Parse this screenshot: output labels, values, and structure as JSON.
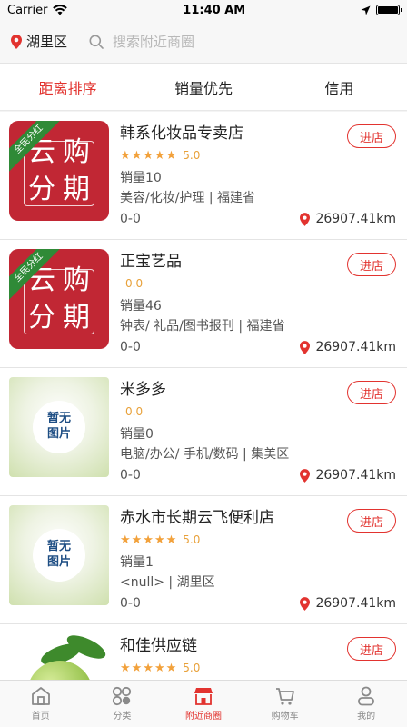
{
  "status_bar": {
    "carrier": "Carrier",
    "time": "11:40 AM"
  },
  "header": {
    "location": "湖里区",
    "search_placeholder": "搜索附近商圈"
  },
  "sort_tabs": [
    {
      "label": "距离排序",
      "active": true
    },
    {
      "label": "销量优先",
      "active": false
    },
    {
      "label": "信用",
      "active": false
    }
  ],
  "stores": [
    {
      "name": "韩系化妆品专卖店",
      "stars": "★★★★★",
      "score": "5.0",
      "sales": "销量10",
      "tags": "美容/化妆/护理 | 福建省",
      "hours": "0-0",
      "distance": "26907.41km",
      "enter_label": "进店",
      "thumb_text": [
        "云",
        "购",
        "分",
        "期"
      ],
      "ribbon": "全民分红"
    },
    {
      "name": "正宝艺品",
      "stars": "",
      "score": "0.0",
      "sales": "销量46",
      "tags": "钟表/ 礼品/图书报刊 | 福建省",
      "hours": "0-0",
      "distance": "26907.41km",
      "enter_label": "进店",
      "thumb_text": [
        "云",
        "购",
        "分",
        "期"
      ],
      "ribbon": "全民分红"
    },
    {
      "name": "米多多",
      "stars": "",
      "score": "0.0",
      "sales": "销量0",
      "tags": "电脑/办公/ 手机/数码 | 集美区",
      "hours": "0-0",
      "distance": "26907.41km",
      "enter_label": "进店",
      "thumb_text": [
        "暂无",
        "图片"
      ]
    },
    {
      "name": "赤水市长期云飞便利店",
      "stars": "★★★★★",
      "score": "5.0",
      "sales": "销量1",
      "tags": "<null> | 湖里区",
      "hours": "0-0",
      "distance": "26907.41km",
      "enter_label": "进店",
      "thumb_text": [
        "暂无",
        "图片"
      ]
    },
    {
      "name": "和佳供应链",
      "stars": "★★★★★",
      "score": "5.0",
      "sales": "",
      "tags": "",
      "hours": "",
      "distance": "",
      "enter_label": "进店"
    }
  ],
  "tab_bar": [
    {
      "label": "首页",
      "icon": "home-icon"
    },
    {
      "label": "分类",
      "icon": "category-icon"
    },
    {
      "label": "附近商圈",
      "icon": "nearby-store-icon",
      "active": true
    },
    {
      "label": "购物车",
      "icon": "cart-icon"
    },
    {
      "label": "我的",
      "icon": "profile-icon"
    }
  ],
  "colors": {
    "accent": "#e2332f",
    "star": "#f2a13b"
  }
}
